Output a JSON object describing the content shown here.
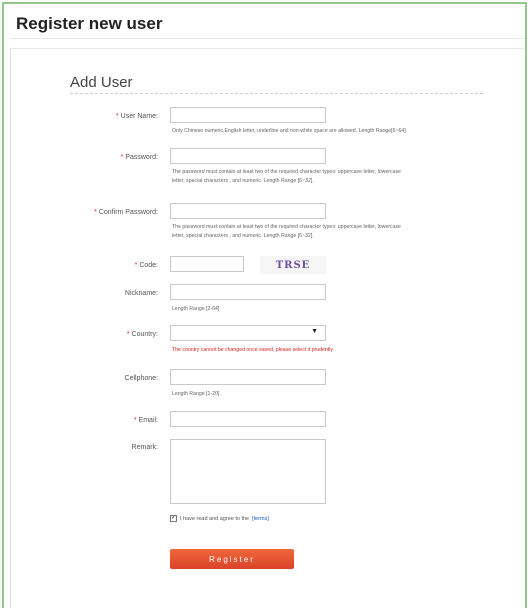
{
  "page": {
    "title": "Register new user"
  },
  "form": {
    "section_title": "Add User",
    "username": {
      "label": "User Name:",
      "hint": "Only Chinese numeric,English letter, underline and non-white space are allowed. Length Range[6~64]."
    },
    "password": {
      "label": "Password:",
      "hint_line1": "The password must contain at least two of the required character types: uppercase letter, lowercase",
      "hint_line2": "letter, special characters , and numeric. Length Range [6~32]."
    },
    "confirm_password": {
      "label": "Confirm Password:",
      "hint_line1": "The password must contain at least two of the required character types: uppercase letter, lowercase",
      "hint_line2": "letter, special characters , and numeric. Length Range [6~32]."
    },
    "code": {
      "label": "Code:",
      "captcha_text": "TRSE"
    },
    "nickname": {
      "label": "Nickname:",
      "hint": "Length Range [2-64]"
    },
    "country": {
      "label": "Country:",
      "selected": "",
      "hint": "The country cannot be changed once saved, please select it prudently."
    },
    "cellphone": {
      "label": "Cellphone:",
      "hint": "Length Range [1-20]"
    },
    "email": {
      "label": "Email:"
    },
    "remark": {
      "label": "Remark:"
    },
    "agree": {
      "text": "I have read and agree to the",
      "link": "[terms]",
      "checked": true
    },
    "register_label": "Register",
    "required_mark": "*",
    "checkbox_mark": "✓",
    "caret": "▼"
  },
  "colors": {
    "accent": "#e4512f",
    "required": "#d22222",
    "frame": "#8fc98a",
    "link": "#1a56c8"
  }
}
